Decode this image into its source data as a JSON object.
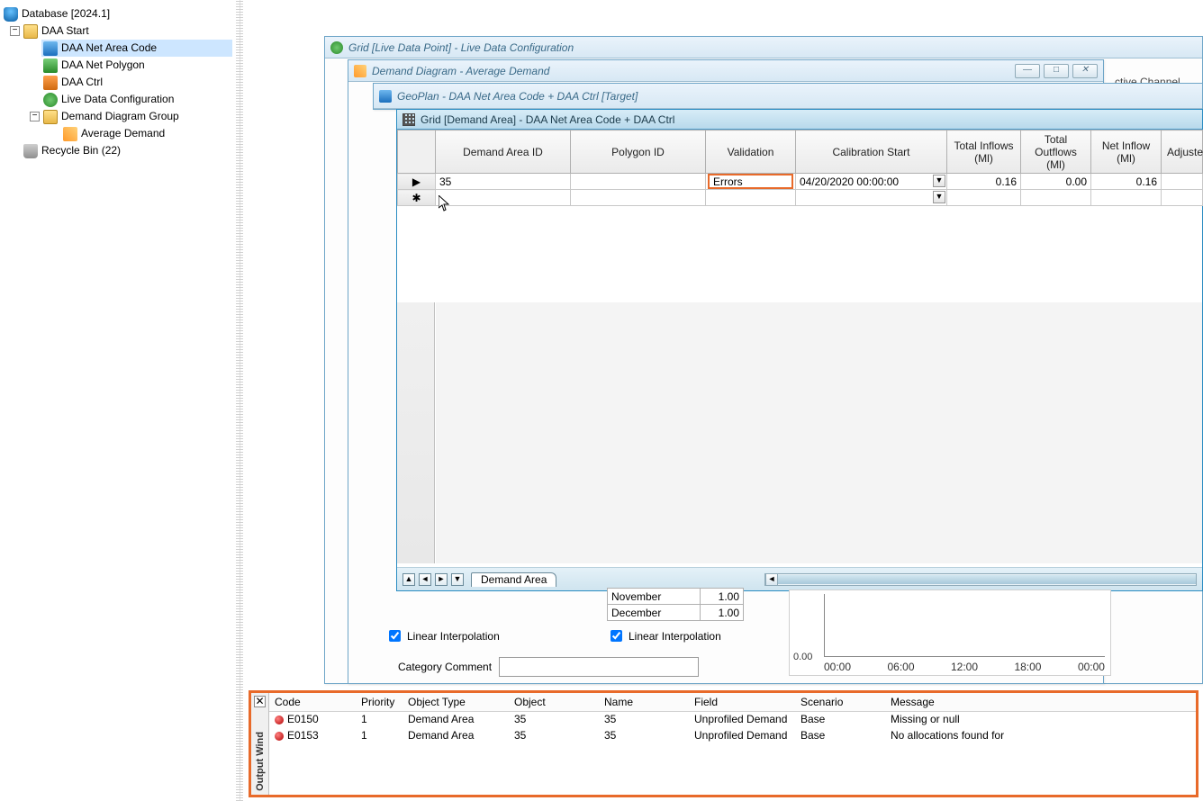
{
  "tree": {
    "root": "Database [2024.1]",
    "daa_start": "DAA Start",
    "net_code": "DAA Net Area Code",
    "net_poly": "DAA Net Polygon",
    "ctrl": "DAA Ctrl",
    "live_cfg": "Live Data Configuration",
    "diag_group": "Demand Diagram Group",
    "avg_demand": "Average Demand",
    "recycle": "Recycle Bin (22)"
  },
  "windows": {
    "live_grid_title": "Grid [Live Data Point] - Live Data Configuration",
    "demand_diagram_title": "Demand Diagram - Average Demand",
    "geoplan_title": "GeoPlan - DAA Net Area Code + DAA Ctrl [Target]",
    "grid_title": "Grid [Demand Area] - DAA Net Area Code + DAA Ctrl",
    "ctive_channel": "ctive Channel"
  },
  "grid": {
    "columns": {
      "demand_area_id": "Demand Area ID",
      "polygon_id": "Polygon ID",
      "validation": "Validation",
      "calibration_start": "Calibration Start",
      "total_inflows": "Total Inflows (Ml)",
      "total_outflows": "Total Outflows (Ml)",
      "net_inflow": "Net Inflow (Ml)",
      "adjusted": "Adjuste"
    },
    "row": {
      "marker": "▶",
      "newmarker": "✱",
      "demand_area_id": "35",
      "polygon_id": "",
      "validation": "Errors",
      "calibration_start": "04/20/2020 00:00:00",
      "total_inflows": "0.16",
      "total_outflows": "0.00",
      "net_inflow": "0.16"
    },
    "sheet_tab": "Demand Area"
  },
  "diagram": {
    "months": [
      {
        "name": "November",
        "value": "1.00"
      },
      {
        "name": "December",
        "value": "1.00"
      }
    ],
    "lin_interp": "Linear Interpolation",
    "category_comment_label": "Category Comment",
    "category_comment_value": ""
  },
  "chart_data": {
    "type": "line",
    "title": "",
    "xlabel": "",
    "ylabel": "",
    "ylim": [
      0.0,
      1.0
    ],
    "yticks": [
      "0.00"
    ],
    "xticks": [
      "00:00",
      "06:00",
      "12:00",
      "18:00",
      "00:00"
    ],
    "series": []
  },
  "output": {
    "vlabel": "Output Wind",
    "columns": {
      "code": "Code",
      "priority": "Priority",
      "object_type": "Object Type",
      "object": "Object",
      "name": "Name",
      "field": "Field",
      "scenario": "Scenario",
      "message": "Message"
    },
    "rows": [
      {
        "code": "E0150",
        "priority": "1",
        "object_type": "Demand Area",
        "object": "35",
        "name": "35",
        "field": "Unprofiled Demand",
        "scenario": "Base",
        "message": "Missing or null"
      },
      {
        "code": "E0153",
        "priority": "1",
        "object_type": "Demand Area",
        "object": "35",
        "name": "35",
        "field": "Unprofiled Demand",
        "scenario": "Base",
        "message": "No allocations found for"
      }
    ]
  },
  "glyph": {
    "minus": "−",
    "min": "—",
    "max": "□",
    "close": "✕",
    "left": "◄",
    "right": "►",
    "up": "▲",
    "down": "▼"
  }
}
